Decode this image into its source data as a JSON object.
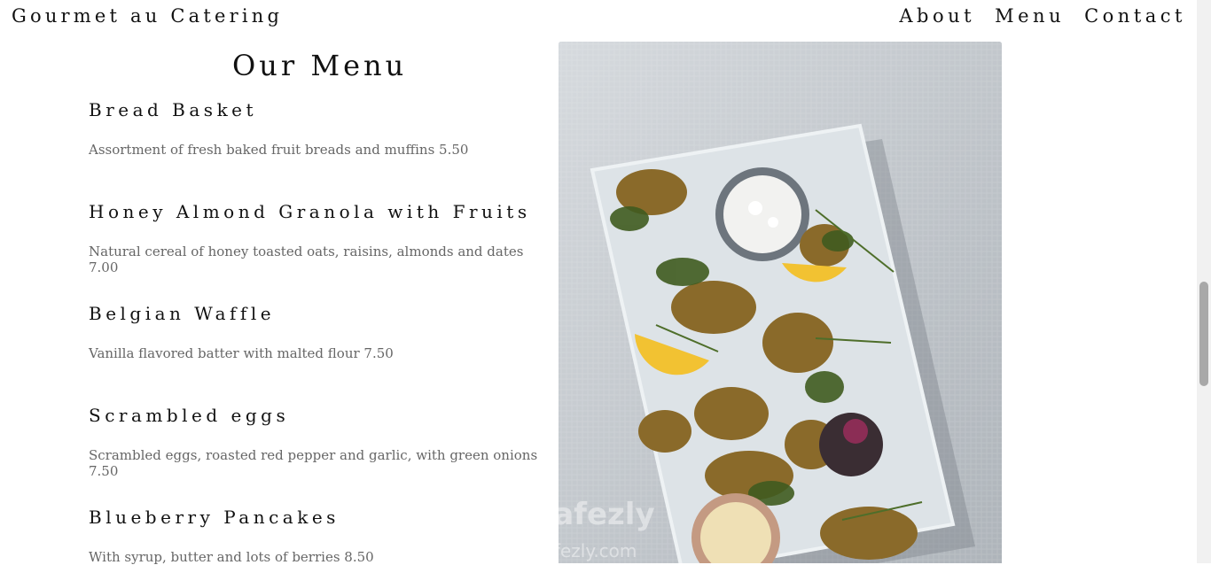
{
  "header": {
    "brand": "Gourmet au Catering",
    "nav": [
      "About",
      "Menu",
      "Contact"
    ]
  },
  "menu": {
    "title": "Our Menu",
    "items": [
      {
        "name": "Bread Basket",
        "description": "Assortment of fresh baked fruit breads and muffins 5.50"
      },
      {
        "name": "Honey Almond Granola with Fruits",
        "description": "Natural cereal of honey toasted oats, raisins, almonds and dates 7.00"
      },
      {
        "name": "Belgian Waffle",
        "description": "Vanilla flavored batter with malted flour 7.50"
      },
      {
        "name": "Scrambled eggs",
        "description": "Scrambled eggs, roasted red pepper and garlic, with green onions 7.50"
      },
      {
        "name": "Blueberry Pancakes",
        "description": "With syrup, butter and lots of berries 8.50"
      }
    ]
  },
  "watermark": "nafezly.com",
  "colors": {
    "text": "#111111",
    "muted": "#666666",
    "background": "#ffffff"
  }
}
